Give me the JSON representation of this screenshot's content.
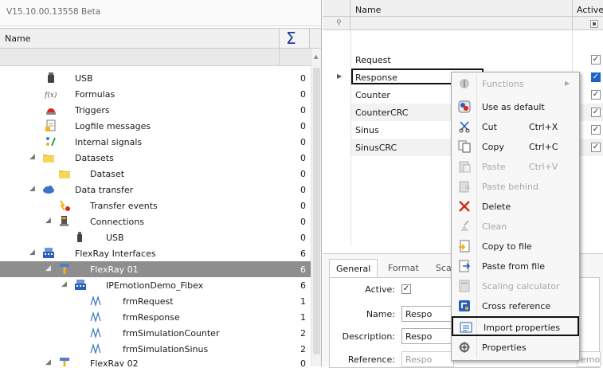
{
  "app": {
    "version": "V15.10.00.13558 Beta"
  },
  "tree": {
    "column_name": "Name",
    "sum_symbol": "Σ",
    "items": [
      {
        "label": "USB",
        "count": "0",
        "icon": "usb-icon",
        "caret": ""
      },
      {
        "label": "Formulas",
        "count": "0",
        "icon": "formula-icon",
        "caret": ""
      },
      {
        "label": "Triggers",
        "count": "0",
        "icon": "trigger-icon",
        "caret": ""
      },
      {
        "label": "Logfile messages",
        "count": "0",
        "icon": "logfile-icon",
        "caret": ""
      },
      {
        "label": "Internal signals",
        "count": "0",
        "icon": "internal-signals-icon",
        "caret": ""
      },
      {
        "label": "Datasets",
        "count": "0",
        "icon": "folder-icon",
        "caret": "◢"
      },
      {
        "label": "Dataset",
        "count": "0",
        "icon": "folder-icon",
        "caret": ""
      },
      {
        "label": "Data transfer",
        "count": "0",
        "icon": "cloud-icon",
        "caret": "◢"
      },
      {
        "label": "Transfer events",
        "count": "0",
        "icon": "transfer-events-icon",
        "caret": ""
      },
      {
        "label": "Connections",
        "count": "0",
        "icon": "connections-icon",
        "caret": "◢"
      },
      {
        "label": "USB",
        "count": "0",
        "icon": "usb-icon",
        "caret": ""
      },
      {
        "label": "FlexRay Interfaces",
        "count": "6",
        "icon": "flexray-interfaces-icon",
        "caret": "◢"
      },
      {
        "label": "FlexRay 01",
        "count": "6",
        "icon": "flexray-port-icon",
        "caret": "◢"
      },
      {
        "label": "IPEmotionDemo_Fibex",
        "count": "6",
        "icon": "fibex-icon",
        "caret": "◢"
      },
      {
        "label": "frmRequest",
        "count": "1",
        "icon": "frame-icon",
        "caret": ""
      },
      {
        "label": "frmResponse",
        "count": "1",
        "icon": "frame-icon",
        "caret": ""
      },
      {
        "label": "frmSimulationCounter",
        "count": "2",
        "icon": "frame-icon",
        "caret": ""
      },
      {
        "label": "frmSimulationSinus",
        "count": "2",
        "icon": "frame-icon",
        "caret": ""
      },
      {
        "label": "FlexRay 02",
        "count": "0",
        "icon": "flexray-port-icon",
        "caret": "◢"
      }
    ]
  },
  "grid": {
    "col_name": "Name",
    "col_active": "Active",
    "rows": [
      {
        "name": "Request",
        "active": "✓"
      },
      {
        "name": "Response",
        "active": "✓"
      },
      {
        "name": "Counter",
        "active": "✓"
      },
      {
        "name": "CounterCRC",
        "active": "✓"
      },
      {
        "name": "Sinus",
        "active": "✓"
      },
      {
        "name": "SinusCRC",
        "active": "✓"
      }
    ]
  },
  "properties": {
    "tabs": [
      "General",
      "Format",
      "Sca"
    ],
    "active_label": "Active:",
    "active_check": "✓",
    "name_label": "Name:",
    "name_value": "Respo",
    "description_label": "Description:",
    "description_value": "Respo",
    "reference_label": "Reference:",
    "reference_value": "Respo",
    "reference_tail": "emo_"
  },
  "context_menu": {
    "items": [
      {
        "label": "Functions",
        "shortcut": "",
        "icon": "functions-icon",
        "disabled": true,
        "submenu": "▶"
      },
      {
        "label": "Use as default",
        "shortcut": "",
        "icon": "use-as-default-icon",
        "disabled": false
      },
      {
        "label": "Cut",
        "shortcut": "Ctrl+X",
        "icon": "scissors-icon",
        "disabled": false
      },
      {
        "label": "Copy",
        "shortcut": "Ctrl+C",
        "icon": "copy-icon",
        "disabled": false
      },
      {
        "label": "Paste",
        "shortcut": "Ctrl+V",
        "icon": "paste-icon",
        "disabled": true
      },
      {
        "label": "Paste behind",
        "shortcut": "",
        "icon": "paste-behind-icon",
        "disabled": true
      },
      {
        "label": "Delete",
        "shortcut": "",
        "icon": "delete-icon",
        "disabled": false
      },
      {
        "label": "Clean",
        "shortcut": "",
        "icon": "clean-icon",
        "disabled": true
      },
      {
        "label": "Copy to file",
        "shortcut": "",
        "icon": "copy-to-file-icon",
        "disabled": false
      },
      {
        "label": "Paste from file",
        "shortcut": "",
        "icon": "paste-from-file-icon",
        "disabled": false
      },
      {
        "label": "Scaling calculator",
        "shortcut": "",
        "icon": "scaling-calculator-icon",
        "disabled": true
      },
      {
        "label": "Cross reference",
        "shortcut": "",
        "icon": "cross-reference-icon",
        "disabled": false
      },
      {
        "label": "Import properties",
        "shortcut": "",
        "icon": "import-properties-icon",
        "disabled": false
      },
      {
        "label": "Properties",
        "shortcut": "",
        "icon": "properties-icon",
        "disabled": false
      }
    ]
  },
  "colors": {
    "selection_blue": "#1e63c6",
    "tree_selected": "#8e8e8e",
    "delete_red": "#d9271b"
  }
}
